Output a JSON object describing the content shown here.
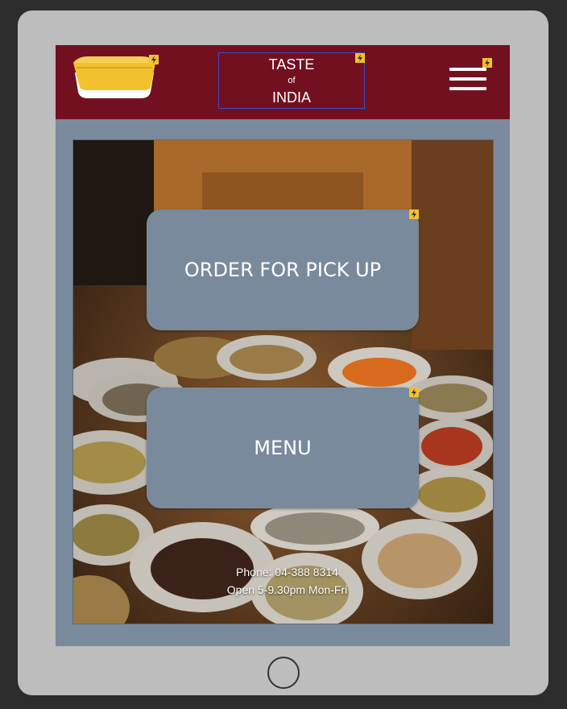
{
  "header": {
    "title_top": "TASTE",
    "title_mid": "of",
    "title_bottom": "INDIA",
    "logo_icon": "food-container-icon",
    "menu_icon": "hamburger-menu-icon",
    "flag_icon": "lightning-bolt-icon"
  },
  "actions": {
    "order_label": "ORDER FOR PICK UP",
    "menu_label": "MENU"
  },
  "contact": {
    "phone": "Phone: 04-388 8314",
    "hours": "Open 5-9.30pm Mon-Fri"
  },
  "colors": {
    "header_bg": "#731020",
    "screen_bg": "#7a8a9d",
    "button_bg": "#7a8a9d",
    "device_frame": "#bdbdbd",
    "background": "#2d2d2d",
    "badge": "#f2c12e"
  }
}
